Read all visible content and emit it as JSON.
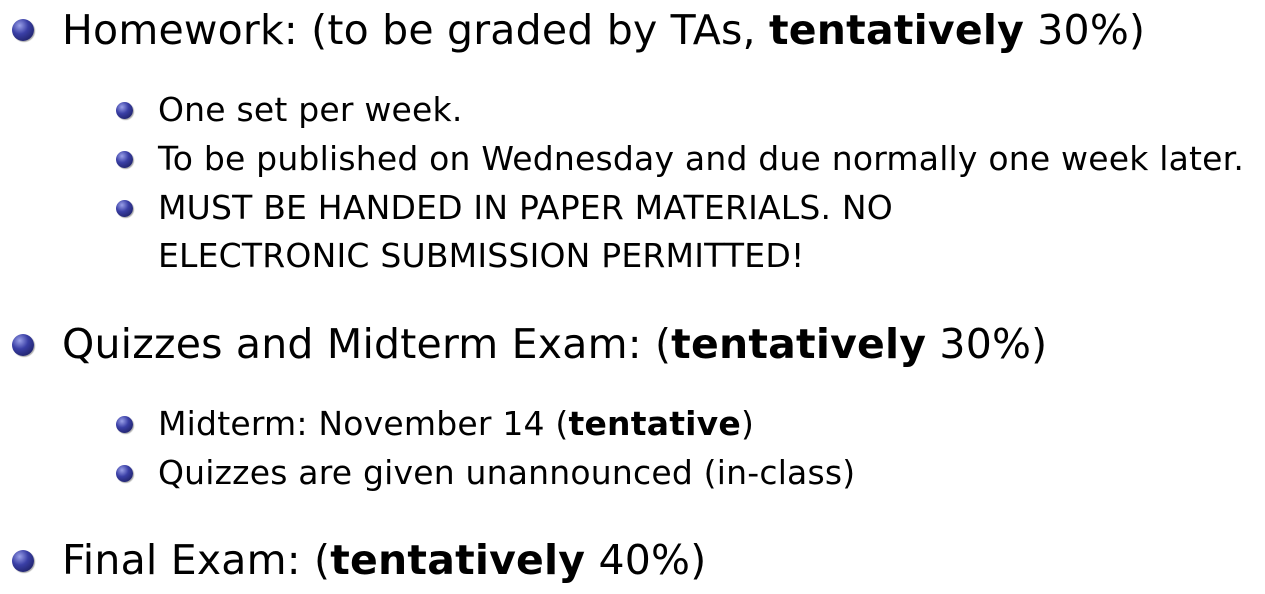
{
  "items": {
    "homework": {
      "lead": "Homework: (to be graded by TAs, ",
      "emph": "tentatively",
      "tail": " 30%)",
      "sub": [
        "One set per week.",
        "To be published on Wednesday and due normally one week later.",
        "MUST BE HANDED IN PAPER MATERIALS. NO",
        "ELECTRONIC SUBMISSION PERMITTED!"
      ]
    },
    "quizzes": {
      "lead": "Quizzes and Midterm Exam: (",
      "emph": "tentatively",
      "tail": " 30%)",
      "sub": {
        "midterm_lead": "Midterm: November 14 (",
        "midterm_emph": "tentative",
        "midterm_tail": ")",
        "quizzes": "Quizzes are given unannounced (in-class)"
      }
    },
    "final": {
      "lead": "Final Exam: (",
      "emph": "tentatively",
      "tail": " 40%)"
    }
  },
  "colors": {
    "bullet": "#2b2f8f",
    "text": "#000000"
  },
  "icons": {
    "level1": "ball-bullet-icon",
    "level2": "small-ball-bullet-icon"
  }
}
